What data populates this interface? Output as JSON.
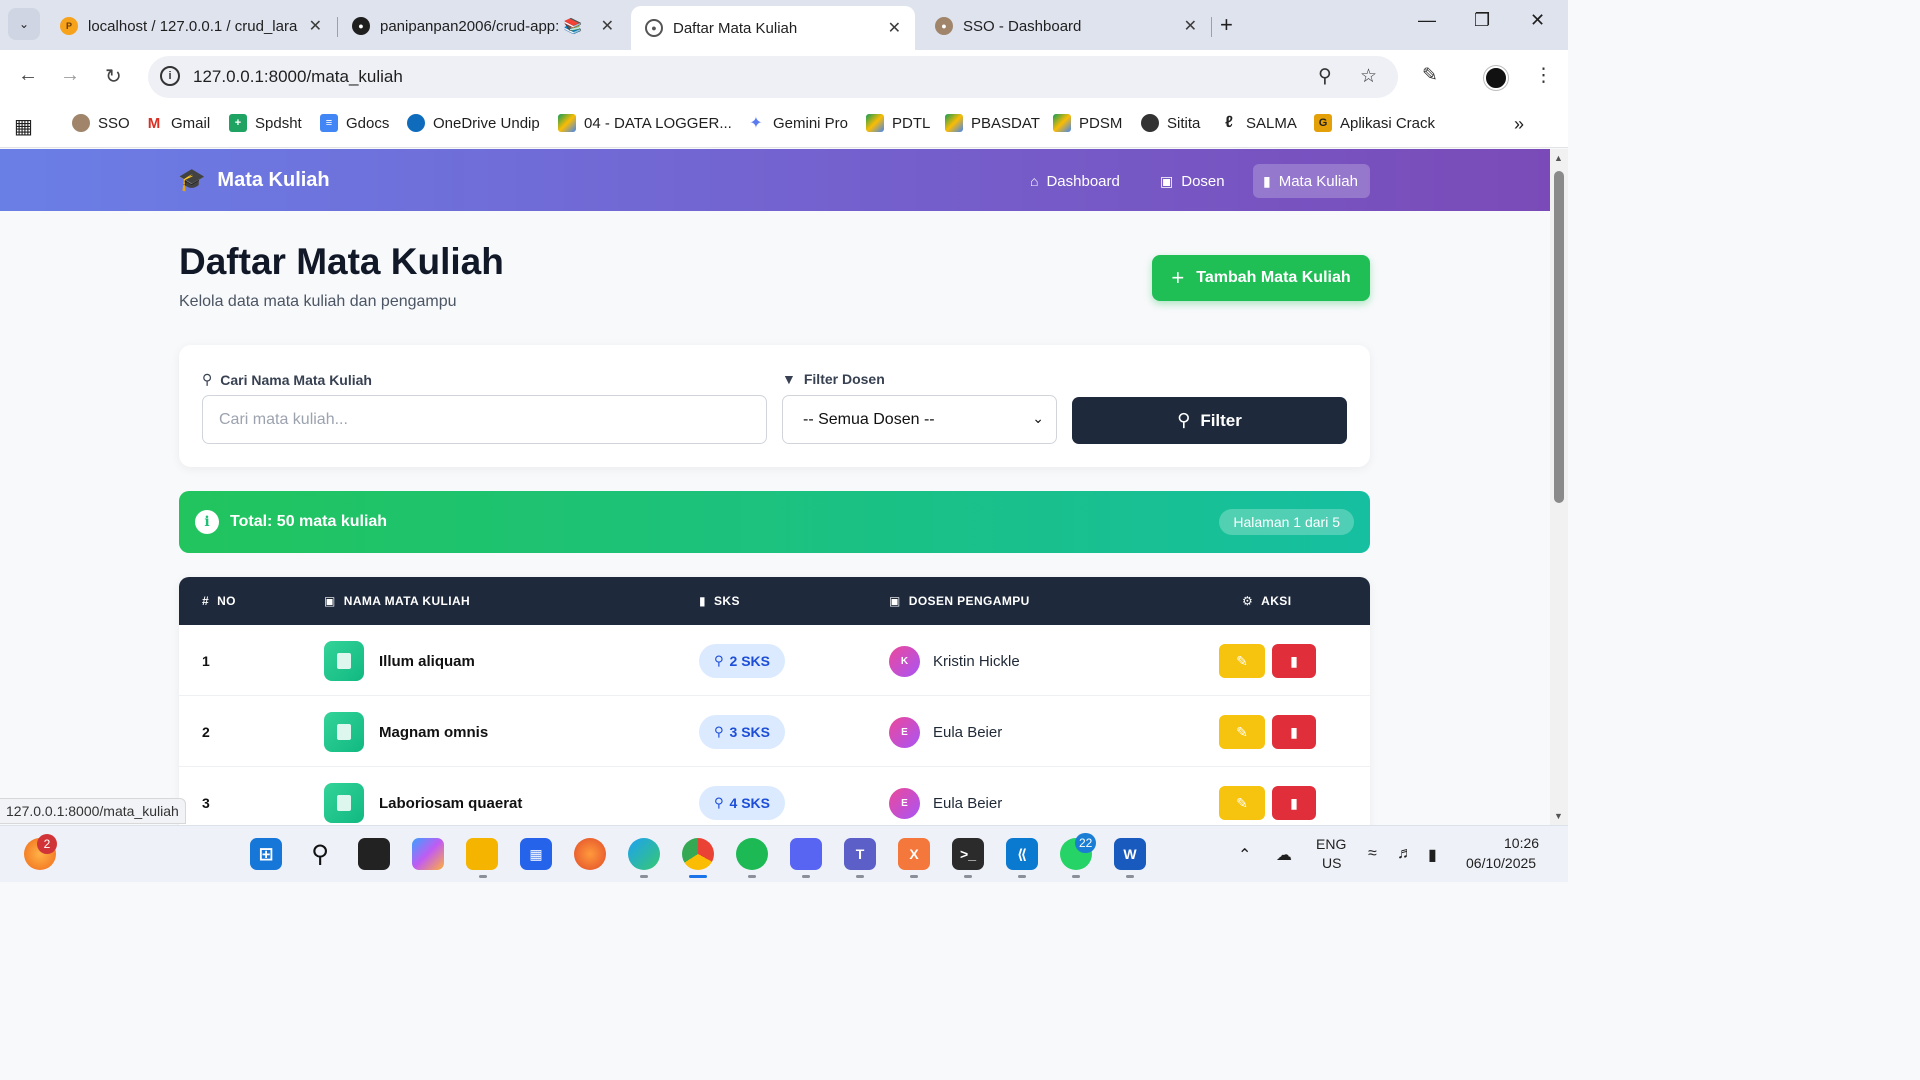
{
  "browser": {
    "tabs": [
      {
        "title": "localhost / 127.0.0.1 / crud_lara",
        "active": false
      },
      {
        "title": "panipanpan2006/crud-app: 📚",
        "active": false
      },
      {
        "title": "Daftar Mata Kuliah",
        "active": true
      },
      {
        "title": "SSO - Dashboard",
        "active": false
      }
    ],
    "url": "127.0.0.1:8000/mata_kuliah",
    "status_url": "127.0.0.1:8000/mata_kuliah",
    "bookmarks": [
      {
        "label": "SSO"
      },
      {
        "label": "Gmail"
      },
      {
        "label": "Spdsht"
      },
      {
        "label": "Gdocs"
      },
      {
        "label": "OneDrive Undip"
      },
      {
        "label": "04 - DATA LOGGER..."
      },
      {
        "label": "Gemini Pro"
      },
      {
        "label": "PDTL"
      },
      {
        "label": "PBASDAT"
      },
      {
        "label": "PDSM"
      },
      {
        "label": "Sitita"
      },
      {
        "label": "SALMA"
      },
      {
        "label": "Aplikasi Crack"
      }
    ]
  },
  "navbar": {
    "brand": "Mata Kuliah",
    "links": [
      {
        "label": "Dashboard",
        "icon": "home-icon"
      },
      {
        "label": "Dosen",
        "icon": "chalkboard-teacher-icon"
      },
      {
        "label": "Mata Kuliah",
        "icon": "book-icon",
        "active": true
      }
    ]
  },
  "header": {
    "title": "Daftar Mata Kuliah",
    "subtitle": "Kelola data mata kuliah dan pengampu",
    "add_button": "Tambah Mata Kuliah"
  },
  "filter": {
    "search_label": "Cari Nama Mata Kuliah",
    "search_placeholder": "Cari mata kuliah...",
    "search_value": "",
    "dosen_label": "Filter Dosen",
    "dosen_selected": "-- Semua Dosen --",
    "button": "Filter"
  },
  "summary": {
    "total": "Total: 50 mata kuliah",
    "page": "Halaman 1 dari 5"
  },
  "table": {
    "headers": [
      "NO",
      "NAMA MATA KULIAH",
      "SKS",
      "DOSEN PENGAMPU",
      "AKSI"
    ],
    "rows": [
      {
        "no": "1",
        "nama": "Illum aliquam",
        "sks": "2 SKS",
        "initial": "K",
        "dosen": "Kristin Hickle"
      },
      {
        "no": "2",
        "nama": "Magnam omnis",
        "sks": "3 SKS",
        "initial": "E",
        "dosen": "Eula Beier"
      },
      {
        "no": "3",
        "nama": "Laboriosam quaerat",
        "sks": "4 SKS",
        "initial": "E",
        "dosen": "Eula Beier"
      }
    ]
  },
  "taskbar": {
    "notification_badge": "2",
    "whatsapp_badge": "22",
    "language": "ENG",
    "region": "US",
    "time": "10:26",
    "date": "06/10/2025"
  },
  "colors": {
    "nav_gradient_start": "#6a7fe6",
    "nav_gradient_end": "#7a4bb8",
    "add_button": "#1fbf56",
    "filter_button": "#1e293b",
    "summary_start": "#21c45d",
    "summary_end": "#16bfa0",
    "edit_button": "#f6c40f",
    "delete_button": "#e02f3a"
  }
}
